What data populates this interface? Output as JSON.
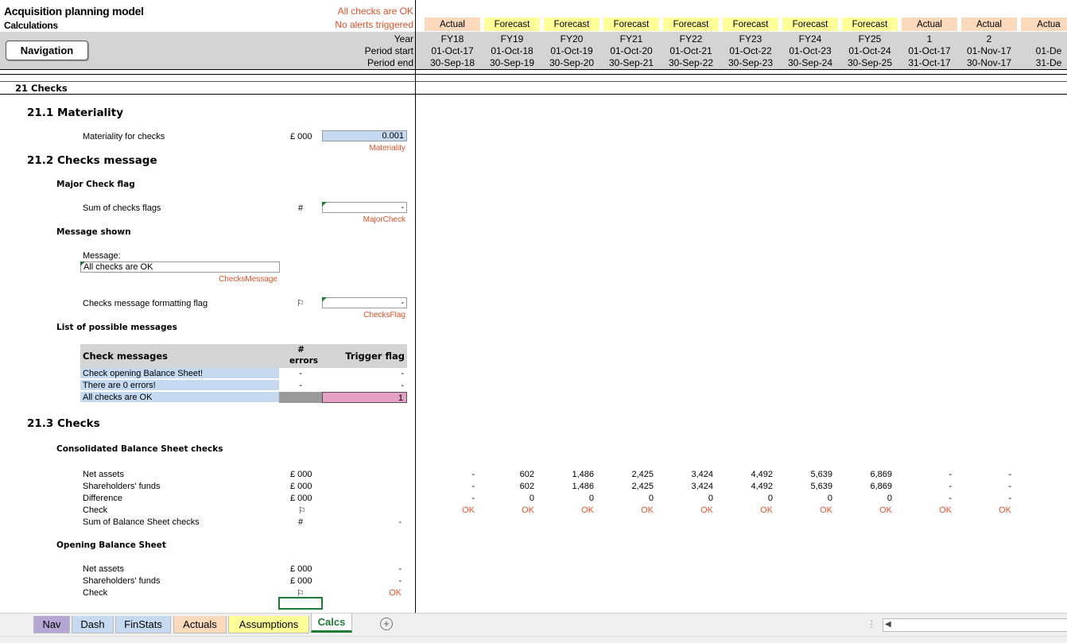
{
  "header": {
    "title": "Acquisition planning model",
    "subtitle": "Calculations",
    "status_ok": "All checks are OK",
    "status_alerts": "No alerts triggered",
    "nav_button": "Navigation",
    "row_labels": [
      "Year",
      "Period start",
      "Period end"
    ]
  },
  "columns": [
    {
      "type": "Actual",
      "year": "FY18",
      "start": "01-Oct-17",
      "end": "30-Sep-18"
    },
    {
      "type": "Forecast",
      "year": "FY19",
      "start": "01-Oct-18",
      "end": "30-Sep-19"
    },
    {
      "type": "Forecast",
      "year": "FY20",
      "start": "01-Oct-19",
      "end": "30-Sep-20"
    },
    {
      "type": "Forecast",
      "year": "FY21",
      "start": "01-Oct-20",
      "end": "30-Sep-21"
    },
    {
      "type": "Forecast",
      "year": "FY22",
      "start": "01-Oct-21",
      "end": "30-Sep-22"
    },
    {
      "type": "Forecast",
      "year": "FY23",
      "start": "01-Oct-22",
      "end": "30-Sep-23"
    },
    {
      "type": "Forecast",
      "year": "FY24",
      "start": "01-Oct-23",
      "end": "30-Sep-24"
    },
    {
      "type": "Forecast",
      "year": "FY25",
      "start": "01-Oct-24",
      "end": "30-Sep-25"
    },
    {
      "type": "Actual",
      "year": "1",
      "start": "01-Oct-17",
      "end": "31-Oct-17"
    },
    {
      "type": "Actual",
      "year": "2",
      "start": "01-Nov-17",
      "end": "30-Nov-17"
    },
    {
      "type": "Actua",
      "year": "",
      "start": "01-De",
      "end": "31-De"
    }
  ],
  "section": {
    "title": "21 Checks",
    "materiality": {
      "heading": "21.1 Materiality",
      "label": "Materiality for checks",
      "unit": "£ 000",
      "value": "0.001",
      "name": "Materiality"
    },
    "message": {
      "heading": "21.2 Checks message",
      "major_flag_heading": "Major Check flag",
      "sum_label": "Sum of checks flags",
      "sum_unit": "#",
      "sum_value": "-",
      "sum_name": "MajorCheck",
      "shown_heading": "Message shown",
      "message_label": "Message:",
      "message_value": "All checks are OK",
      "message_name": "ChecksMessage",
      "format_label": "Checks message formatting flag",
      "format_unit": "⚐",
      "format_value": "-",
      "format_name": "ChecksFlag",
      "list_heading": "List of possible messages",
      "table_headers": [
        "Check messages",
        "#",
        "errors",
        "Trigger flag"
      ],
      "table_rows": [
        {
          "msg": "Check opening Balance Sheet!",
          "errors": "-",
          "flag": "-"
        },
        {
          "msg": "There are 0 errors!",
          "errors": "-",
          "flag": "-"
        },
        {
          "msg": "All checks are OK",
          "errors": "",
          "flag": "1"
        }
      ]
    },
    "checks": {
      "heading": "21.3 Checks",
      "consolidated_heading": "Consolidated Balance Sheet checks",
      "rows": [
        {
          "label": "Net assets",
          "unit": "£ 000",
          "total": "",
          "values": [
            "-",
            "602",
            "1,486",
            "2,425",
            "3,424",
            "4,492",
            "5,639",
            "6,869",
            "-",
            "-"
          ]
        },
        {
          "label": "Shareholders' funds",
          "unit": "£ 000",
          "total": "",
          "values": [
            "-",
            "602",
            "1,486",
            "2,425",
            "3,424",
            "4,492",
            "5,639",
            "6,869",
            "-",
            "-"
          ]
        },
        {
          "label": "Difference",
          "unit": "£ 000",
          "total": "",
          "values": [
            "-",
            "0",
            "0",
            "0",
            "0",
            "0",
            "0",
            "0",
            "-",
            "-"
          ]
        },
        {
          "label": "Check",
          "unit": "⚐",
          "total": "",
          "values": [
            "OK",
            "OK",
            "OK",
            "OK",
            "OK",
            "OK",
            "OK",
            "OK",
            "OK",
            "OK"
          ]
        },
        {
          "label": "Sum of Balance Sheet checks",
          "unit": "#",
          "total": "-",
          "values": []
        }
      ],
      "opening_heading": "Opening Balance Sheet",
      "opening_rows": [
        {
          "label": "Net assets",
          "unit": "£ 000",
          "value": "-"
        },
        {
          "label": "Shareholders' funds",
          "unit": "£ 000",
          "value": "-"
        },
        {
          "label": "Check",
          "unit": "⚐",
          "value": "OK"
        }
      ]
    }
  },
  "tabs": [
    {
      "label": "Nav",
      "color": "#b4a7d6"
    },
    {
      "label": "Dash",
      "color": "#c5d9f1"
    },
    {
      "label": "FinStats",
      "color": "#c5d9f1"
    },
    {
      "label": "Actuals",
      "color": "#fbd9bd"
    },
    {
      "label": "Assumptions",
      "color": "#ffff99"
    },
    {
      "label": "Calcs",
      "color": "#ffffff"
    }
  ],
  "colors": {
    "accent": "#e0522a",
    "actual": "#fbd9bd",
    "forecast": "#ffff99",
    "input": "#c5d9f1",
    "flag": "#e6a0c4",
    "tab_active": "#1e7a35"
  }
}
